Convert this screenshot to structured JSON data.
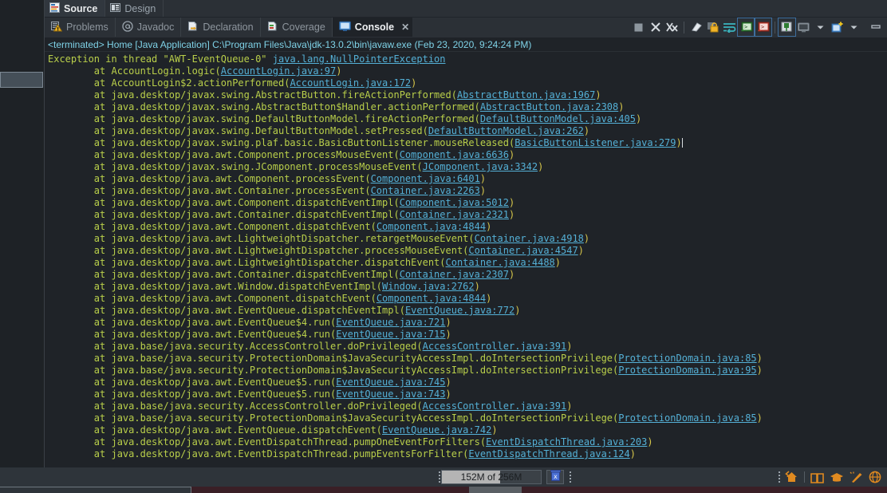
{
  "editor_tabs": [
    {
      "label": "Source",
      "icon": "source-file-icon",
      "active": true
    },
    {
      "label": "Design",
      "icon": "design-layout-icon",
      "active": false
    }
  ],
  "view_tabs": [
    {
      "label": "Problems",
      "icon": "problems-warning-icon",
      "active": false
    },
    {
      "label": "Javadoc",
      "icon": "javadoc-at-icon",
      "active": false
    },
    {
      "label": "Declaration",
      "icon": "declaration-arrow-icon",
      "active": false
    },
    {
      "label": "Coverage",
      "icon": "coverage-bars-icon",
      "active": false
    },
    {
      "label": "Console",
      "icon": "console-monitor-icon",
      "active": true,
      "close": "✕"
    }
  ],
  "view_toolbar": [
    {
      "name": "terminate-button",
      "icon": "stop-square-icon"
    },
    {
      "name": "remove-launch-button",
      "icon": "remove-x-icon"
    },
    {
      "name": "remove-all-launches-button",
      "icon": "remove-all-xx-icon"
    },
    {
      "name": "clear-console-button",
      "icon": "eraser-icon"
    },
    {
      "name": "scroll-lock-button",
      "icon": "lock-icon"
    },
    {
      "name": "word-wrap-button",
      "icon": "word-wrap-icon"
    },
    {
      "name": "show-console-stdout-button",
      "icon": "console-green-icon"
    },
    {
      "name": "show-console-stderr-button",
      "icon": "console-red-icon"
    },
    {
      "name": "pin-console-button",
      "icon": "pin-icon"
    },
    {
      "name": "display-selected-console-button",
      "icon": "monitor-icon"
    },
    {
      "name": "display-selected-console-dropdown",
      "icon": "chevron-down-icon"
    },
    {
      "name": "open-console-button",
      "icon": "new-console-icon"
    },
    {
      "name": "open-console-dropdown",
      "icon": "chevron-down-icon"
    },
    {
      "name": "minimize-view-button",
      "icon": "minimize-icon"
    }
  ],
  "console": {
    "process_label": "<terminated> Home [Java Application] C:\\Program Files\\Java\\jdk-13.0.2\\bin\\javaw.exe (Feb 23, 2020, 9:24:24 PM)",
    "exception_header": {
      "text": "Exception in thread \"AWT-EventQueue-0\" ",
      "type": "java.lang.NullPointerException"
    },
    "frames": [
      {
        "indent": 8,
        "call": "at AccountLogin.logic(",
        "link": "AccountLogin.java:97",
        "tail": ")"
      },
      {
        "indent": 8,
        "call": "at AccountLogin$2.actionPerformed(",
        "link": "AccountLogin.java:172",
        "tail": ")"
      },
      {
        "indent": 8,
        "call": "at java.desktop/javax.swing.AbstractButton.fireActionPerformed(",
        "link": "AbstractButton.java:1967",
        "tail": ")"
      },
      {
        "indent": 8,
        "call": "at java.desktop/javax.swing.AbstractButton$Handler.actionPerformed(",
        "link": "AbstractButton.java:2308",
        "tail": ")"
      },
      {
        "indent": 8,
        "call": "at java.desktop/javax.swing.DefaultButtonModel.fireActionPerformed(",
        "link": "DefaultButtonModel.java:405",
        "tail": ")"
      },
      {
        "indent": 8,
        "call": "at java.desktop/javax.swing.DefaultButtonModel.setPressed(",
        "link": "DefaultButtonModel.java:262",
        "tail": ")"
      },
      {
        "indent": 8,
        "call": "at java.desktop/javax.swing.plaf.basic.BasicButtonListener.mouseReleased(",
        "link": "BasicButtonListener.java:279",
        "tail": ")",
        "caret": true
      },
      {
        "indent": 8,
        "call": "at java.desktop/java.awt.Component.processMouseEvent(",
        "link": "Component.java:6636",
        "tail": ")"
      },
      {
        "indent": 8,
        "call": "at java.desktop/javax.swing.JComponent.processMouseEvent(",
        "link": "JComponent.java:3342",
        "tail": ")"
      },
      {
        "indent": 8,
        "call": "at java.desktop/java.awt.Component.processEvent(",
        "link": "Component.java:6401",
        "tail": ")"
      },
      {
        "indent": 8,
        "call": "at java.desktop/java.awt.Container.processEvent(",
        "link": "Container.java:2263",
        "tail": ")"
      },
      {
        "indent": 8,
        "call": "at java.desktop/java.awt.Component.dispatchEventImpl(",
        "link": "Component.java:5012",
        "tail": ")"
      },
      {
        "indent": 8,
        "call": "at java.desktop/java.awt.Container.dispatchEventImpl(",
        "link": "Container.java:2321",
        "tail": ")"
      },
      {
        "indent": 8,
        "call": "at java.desktop/java.awt.Component.dispatchEvent(",
        "link": "Component.java:4844",
        "tail": ")"
      },
      {
        "indent": 8,
        "call": "at java.desktop/java.awt.LightweightDispatcher.retargetMouseEvent(",
        "link": "Container.java:4918",
        "tail": ")"
      },
      {
        "indent": 8,
        "call": "at java.desktop/java.awt.LightweightDispatcher.processMouseEvent(",
        "link": "Container.java:4547",
        "tail": ")"
      },
      {
        "indent": 8,
        "call": "at java.desktop/java.awt.LightweightDispatcher.dispatchEvent(",
        "link": "Container.java:4488",
        "tail": ")"
      },
      {
        "indent": 8,
        "call": "at java.desktop/java.awt.Container.dispatchEventImpl(",
        "link": "Container.java:2307",
        "tail": ")"
      },
      {
        "indent": 8,
        "call": "at java.desktop/java.awt.Window.dispatchEventImpl(",
        "link": "Window.java:2762",
        "tail": ")"
      },
      {
        "indent": 8,
        "call": "at java.desktop/java.awt.Component.dispatchEvent(",
        "link": "Component.java:4844",
        "tail": ")"
      },
      {
        "indent": 8,
        "call": "at java.desktop/java.awt.EventQueue.dispatchEventImpl(",
        "link": "EventQueue.java:772",
        "tail": ")"
      },
      {
        "indent": 8,
        "call": "at java.desktop/java.awt.EventQueue$4.run(",
        "link": "EventQueue.java:721",
        "tail": ")"
      },
      {
        "indent": 8,
        "call": "at java.desktop/java.awt.EventQueue$4.run(",
        "link": "EventQueue.java:715",
        "tail": ")"
      },
      {
        "indent": 8,
        "call": "at java.base/java.security.AccessController.doPrivileged(",
        "link": "AccessController.java:391",
        "tail": ")"
      },
      {
        "indent": 8,
        "call": "at java.base/java.security.ProtectionDomain$JavaSecurityAccessImpl.doIntersectionPrivilege(",
        "link": "ProtectionDomain.java:85",
        "tail": ")"
      },
      {
        "indent": 8,
        "call": "at java.base/java.security.ProtectionDomain$JavaSecurityAccessImpl.doIntersectionPrivilege(",
        "link": "ProtectionDomain.java:95",
        "tail": ")"
      },
      {
        "indent": 8,
        "call": "at java.desktop/java.awt.EventQueue$5.run(",
        "link": "EventQueue.java:745",
        "tail": ")"
      },
      {
        "indent": 8,
        "call": "at java.desktop/java.awt.EventQueue$5.run(",
        "link": "EventQueue.java:743",
        "tail": ")"
      },
      {
        "indent": 8,
        "call": "at java.base/java.security.AccessController.doPrivileged(",
        "link": "AccessController.java:391",
        "tail": ")"
      },
      {
        "indent": 8,
        "call": "at java.base/java.security.ProtectionDomain$JavaSecurityAccessImpl.doIntersectionPrivilege(",
        "link": "ProtectionDomain.java:85",
        "tail": ")"
      },
      {
        "indent": 8,
        "call": "at java.desktop/java.awt.EventQueue.dispatchEvent(",
        "link": "EventQueue.java:742",
        "tail": ")"
      },
      {
        "indent": 8,
        "call": "at java.desktop/java.awt.EventDispatchThread.pumpOneEventForFilters(",
        "link": "EventDispatchThread.java:203",
        "tail": ")"
      },
      {
        "indent": 8,
        "call": "at java.desktop/java.awt.EventDispatchThread.pumpEventsForFilter(",
        "link": "EventDispatchThread.java:124",
        "tail": ")"
      }
    ]
  },
  "statusbar": {
    "heap_text": "152M of 256M",
    "heap_used_percent": 59,
    "trash_icon": "trash-can-icon",
    "right_icons": [
      {
        "name": "home-button",
        "icon": "home-icon"
      },
      {
        "name": "book-button",
        "icon": "open-book-icon"
      },
      {
        "name": "tutorial-button",
        "icon": "graduation-cap-icon"
      },
      {
        "name": "whatsnew-button",
        "icon": "pencil-wand-icon"
      },
      {
        "name": "web-resources-button",
        "icon": "globe-icon"
      }
    ]
  },
  "colors": {
    "console_bg": "#1f2328",
    "chrome_bg": "#2b3036",
    "trace_text": "#b9cf4a",
    "link_text": "#54b0d6",
    "number_text": "#d6c64a",
    "process_text": "#7fd3e8"
  }
}
